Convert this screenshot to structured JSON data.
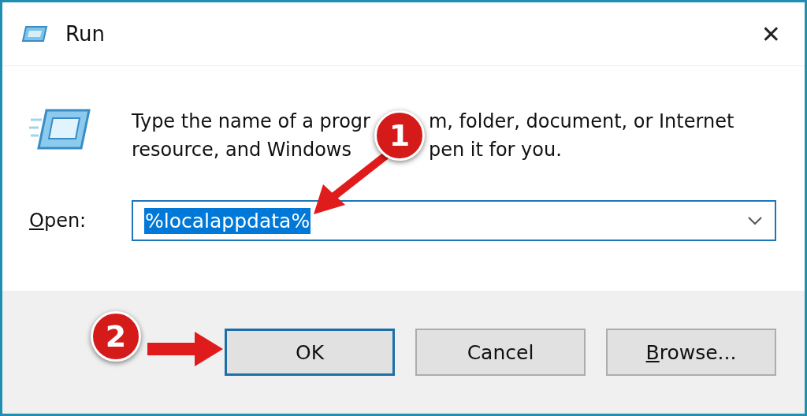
{
  "window": {
    "title": "Run",
    "close": "✕"
  },
  "description_lines": [
    {
      "before": "Type the name of a progr",
      "after": "m, folder, document, or Internet"
    },
    {
      "before": "resource, and Windows",
      "after": "pen it for you."
    }
  ],
  "open_field": {
    "label": "Open:",
    "access_key": true,
    "value": "%localappdata%",
    "selected": true
  },
  "buttons": [
    {
      "label": "OK",
      "default": true,
      "access_key": false
    },
    {
      "label": "Cancel",
      "default": false,
      "access_key": false
    },
    {
      "label": "Browse...",
      "default": false,
      "access_key": true
    }
  ],
  "annotations": [
    {
      "label": "1",
      "kind": "field"
    },
    {
      "label": "2",
      "kind": "button"
    }
  ]
}
